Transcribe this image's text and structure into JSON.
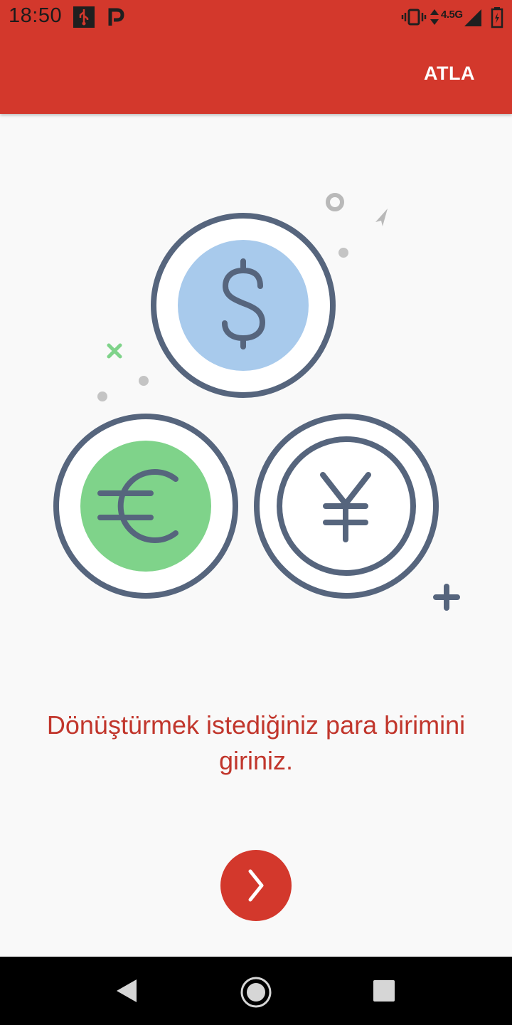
{
  "status_bar": {
    "time": "18:50",
    "network_type": "4.5G",
    "icons": [
      "usb-icon",
      "parking-app-icon",
      "vibrate-icon",
      "data-arrows-icon",
      "signal-icon",
      "battery-charging-icon"
    ]
  },
  "toolbar": {
    "skip_label": "ATLA"
  },
  "illustration": {
    "icons": [
      "dollar-coin-icon",
      "euro-coin-icon",
      "yen-coin-icon"
    ]
  },
  "onboarding": {
    "message": "Dönüştürmek istediğiniz para birimini giriniz."
  },
  "next_button": {
    "icon": "chevron-right-icon"
  },
  "navigation_bar": {
    "buttons": [
      "back-icon",
      "home-icon",
      "recents-icon"
    ]
  },
  "colors": {
    "primary": "#d3382c",
    "message_text": "#c1362c",
    "background": "#f9f9f9",
    "coin_outline": "#56657d",
    "dollar_fill": "#a8caec",
    "euro_fill": "#7fd38a"
  }
}
